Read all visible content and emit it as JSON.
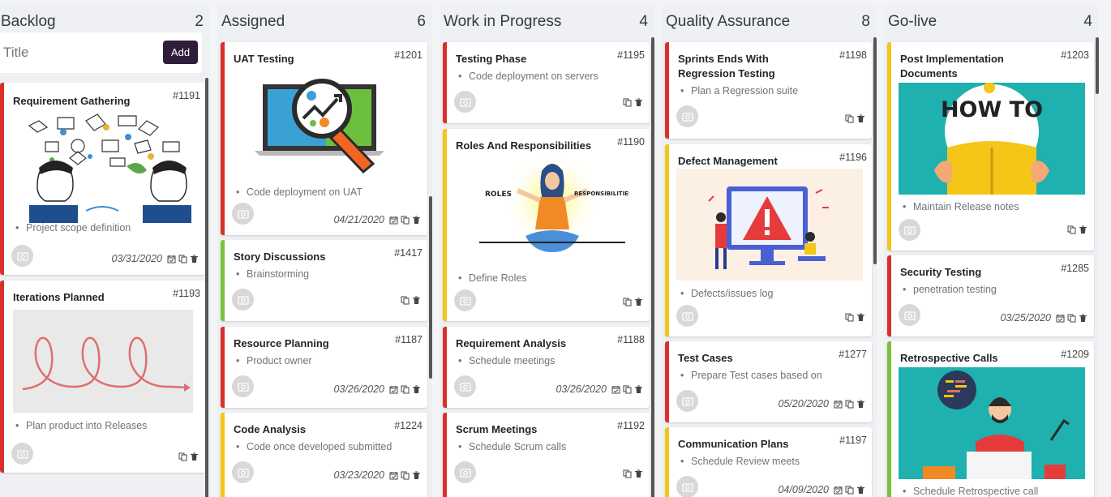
{
  "columns": [
    {
      "title": "Backlog",
      "count": "2"
    },
    {
      "title": "Assigned",
      "count": "6"
    },
    {
      "title": "Work in Progress",
      "count": "4"
    },
    {
      "title": "Quality Assurance",
      "count": "8"
    },
    {
      "title": "Go-live",
      "count": "4"
    }
  ],
  "new_card": {
    "placeholder": "Title",
    "add_label": "Add"
  },
  "cards": {
    "c1191": {
      "title": "Requirement Gathering",
      "id": "#1191",
      "bullet": "Project scope definition",
      "date": "03/31/2020"
    },
    "c1193": {
      "title": "Iterations Planned",
      "id": "#1193",
      "bullet": "Plan product into Releases"
    },
    "c1201": {
      "title": "UAT Testing",
      "id": "#1201",
      "bullet": "Code deployment on UAT",
      "date": "04/21/2020"
    },
    "c1417": {
      "title": "Story Discussions",
      "id": "#1417",
      "bullet": "Brainstorming"
    },
    "c1187": {
      "title": "Resource Planning",
      "id": "#1187",
      "bullet": "Product owner",
      "date": "03/26/2020"
    },
    "c1224": {
      "title": "Code Analysis",
      "id": "#1224",
      "bullet": "Code once developed submitted",
      "date": "03/23/2020"
    },
    "c1195": {
      "title": "Testing Phase",
      "id": "#1195",
      "bullet": "Code deployment on servers"
    },
    "c1190": {
      "title": "Roles And Responsibilities",
      "id": "#1190",
      "bullet": "Define Roles",
      "img_left": "ROLES",
      "img_right": "RESPONSIBILITIES"
    },
    "c1188": {
      "title": "Requirement Analysis",
      "id": "#1188",
      "bullet": "Schedule meetings",
      "date": "03/26/2020"
    },
    "c1192": {
      "title": "Scrum Meetings",
      "id": "#1192",
      "bullet": "Schedule Scrum calls"
    },
    "c1198": {
      "title": "Sprints Ends With Regression Testing",
      "id": "#1198",
      "bullet": "Plan a Regression suite"
    },
    "c1196": {
      "title": "Defect Management",
      "id": "#1196",
      "bullet": "Defects/issues log"
    },
    "c1277": {
      "title": "Test Cases",
      "id": "#1277",
      "bullet": "Prepare Test cases based on",
      "date": "05/20/2020"
    },
    "c1197": {
      "title": "Communication Plans",
      "id": "#1197",
      "bullet": "Schedule Review meets",
      "date": "04/09/2020"
    },
    "c1203": {
      "title": "Post Implementation Documents",
      "id": "#1203",
      "bullet": "Maintain Release notes",
      "img_text": "HOW TO"
    },
    "c1285": {
      "title": "Security Testing",
      "id": "#1285",
      "bullet": "penetration testing",
      "date": "03/25/2020"
    },
    "c1209": {
      "title": "Retrospective Calls",
      "id": "#1209",
      "bullet": "Schedule Retrospective call"
    }
  },
  "colors": {
    "red": "#d9302c",
    "yellow": "#f5c518",
    "green": "#7cc03b",
    "accent": "#2f1d3a"
  },
  "icons": [
    "avatar-icon",
    "calendar-icon",
    "copy-icon",
    "trash-icon"
  ]
}
